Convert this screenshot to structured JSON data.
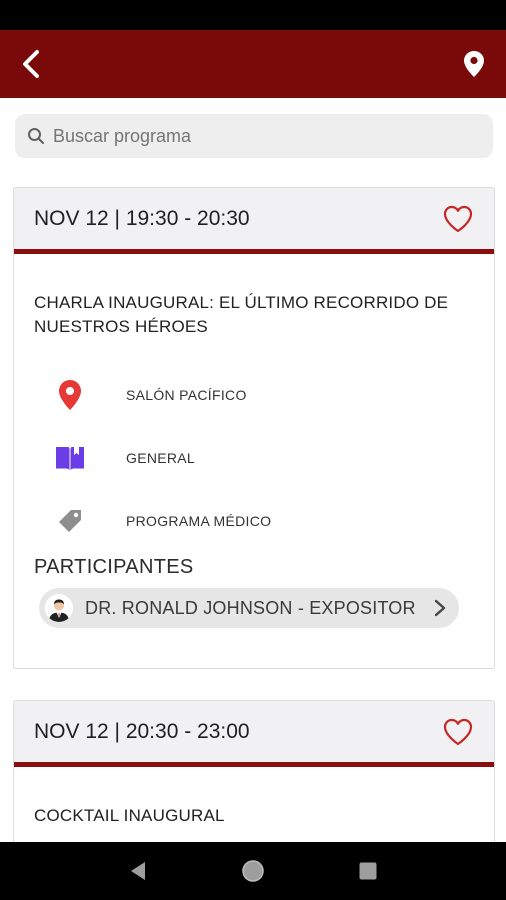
{
  "search": {
    "placeholder": "Buscar programa"
  },
  "events": [
    {
      "time": "NOV 12 | 19:30 - 20:30",
      "title": "CHARLA INAUGURAL: EL ÚLTIMO RECORRIDO DE NUESTROS HÉROES",
      "location": "SALÓN PACÍFICO",
      "category": "GENERAL",
      "program": "PROGRAMA MÉDICO",
      "participants_label": "PARTICIPANTES",
      "participant": "DR. RONALD JOHNSON - EXPOSITOR"
    },
    {
      "time": "NOV 12 | 20:30 - 23:00",
      "title": "COCKTAIL INAUGURAL"
    }
  ],
  "colors": {
    "app_bar": "#7a0a0a",
    "accent_line": "#8b0d0d",
    "heart": "#c62828",
    "pin": "#e53935",
    "book": "#6a3de8",
    "tag": "#8e8e8e"
  },
  "icons": {
    "back": "back-arrow-icon",
    "map": "map-pin-icon",
    "favorite": "heart-outline-icon"
  }
}
